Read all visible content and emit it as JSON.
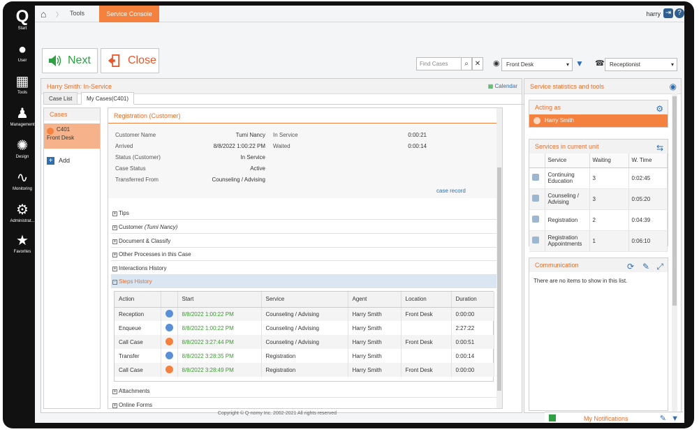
{
  "nav": {
    "logo": "Q",
    "items": [
      {
        "label": "Start",
        "icon": "q-logo-icon"
      },
      {
        "label": "User",
        "icon": "user-icon"
      },
      {
        "label": "Tools",
        "icon": "calendar-icon"
      },
      {
        "label": "Management",
        "icon": "management-icon"
      },
      {
        "label": "Design",
        "icon": "palette-icon"
      },
      {
        "label": "Monitoring",
        "icon": "pulse-icon"
      },
      {
        "label": "Administrat...",
        "icon": "gears-icon"
      },
      {
        "label": "Favorites",
        "icon": "star-icon"
      }
    ]
  },
  "topbar": {
    "crumb_tools": "Tools",
    "active_tab": "Service Console",
    "username": "harry"
  },
  "toolbar": {
    "next": "Next",
    "close": "Close",
    "find_placeholder": "Find Cases",
    "location": "Front Desk",
    "role": "Receptionist"
  },
  "panel": {
    "title": "Harry Smith: In-Service",
    "calendar": "Calendar",
    "tabs": [
      "Case List",
      "My Cases(C401)"
    ]
  },
  "cases": {
    "header": "Cases",
    "case_id": "C401",
    "case_loc": "Front Desk",
    "add": "Add"
  },
  "registration": {
    "header": "Registration (Customer)",
    "fields": [
      {
        "label": "Customer Name",
        "value": "Tumi Nancy"
      },
      {
        "label": "Arrived",
        "value": "8/8/2022 1:00:22 PM"
      },
      {
        "label": "Status (Customer)",
        "value": "In Service"
      },
      {
        "label": "Case Status",
        "value": "Active"
      },
      {
        "label": "Transferred From",
        "value": "Counseling / Advising"
      }
    ],
    "times": [
      {
        "label": "In Service",
        "value": "0:00:21"
      },
      {
        "label": "Waited",
        "value": "0:00:14"
      }
    ],
    "case_record": "case record",
    "sections": [
      "Tips",
      "Customer",
      "Document & Classify",
      "Other Processes in this Case",
      "Interactions History",
      "Steps History",
      "Attachments",
      "Online Forms"
    ],
    "customer_name_italic": "(Tumi Nancy)"
  },
  "steps": {
    "headers": [
      "Action",
      "Start",
      "Service",
      "Agent",
      "Location",
      "Duration"
    ],
    "rows": [
      {
        "action": "Reception",
        "start": "8/8/2022 1:00:22 PM",
        "service": "Counseling / Advising",
        "agent": "Harry Smith",
        "location": "Front Desk",
        "duration": "0:00:00",
        "color": "#5b8fd6"
      },
      {
        "action": "Enqueue",
        "start": "8/8/2022 1:00:22 PM",
        "service": "Counseling / Advising",
        "agent": "Harry Smith",
        "location": "",
        "duration": "2:27:22",
        "color": "#5b8fd6"
      },
      {
        "action": "Call Case",
        "start": "8/8/2022 3:27:44 PM",
        "service": "Counseling / Advising",
        "agent": "Harry Smith",
        "location": "Front Desk",
        "duration": "0:00:51",
        "color": "#f5813f"
      },
      {
        "action": "Transfer",
        "start": "8/8/2022 3:28:35 PM",
        "service": "Registration",
        "agent": "Harry Smith",
        "location": "",
        "duration": "0:00:14",
        "color": "#5b8fd6"
      },
      {
        "action": "Call Case",
        "start": "8/8/2022 3:28:49 PM",
        "service": "Registration",
        "agent": "Harry Smith",
        "location": "Front Desk",
        "duration": "0:00:00",
        "color": "#f5813f"
      }
    ]
  },
  "stats": {
    "title": "Service statistics and tools",
    "acting_as": "Acting as",
    "acting_name": "Harry Smith",
    "services_title": "Services in current unit",
    "svc_headers": [
      "Service",
      "Waiting",
      "W. Time"
    ],
    "services": [
      {
        "name": "Continuing Education",
        "waiting": "3",
        "wtime": "0:02:45"
      },
      {
        "name": "Counseling / Advising",
        "waiting": "3",
        "wtime": "0:05:20"
      },
      {
        "name": "Registration",
        "waiting": "2",
        "wtime": "0:04:39"
      },
      {
        "name": "Registration Appointments",
        "waiting": "1",
        "wtime": "0:06:10"
      }
    ],
    "communication": "Communication",
    "empty": "There are no items to show in this list."
  },
  "footer": {
    "copyright": "Copyright © Q-nomy Inc. 2002-2021 All rights reserved",
    "notifications": "My Notifications"
  },
  "colors": {
    "accent": "#f5813f",
    "blue": "#2f6eb0",
    "green": "#2ea043"
  }
}
